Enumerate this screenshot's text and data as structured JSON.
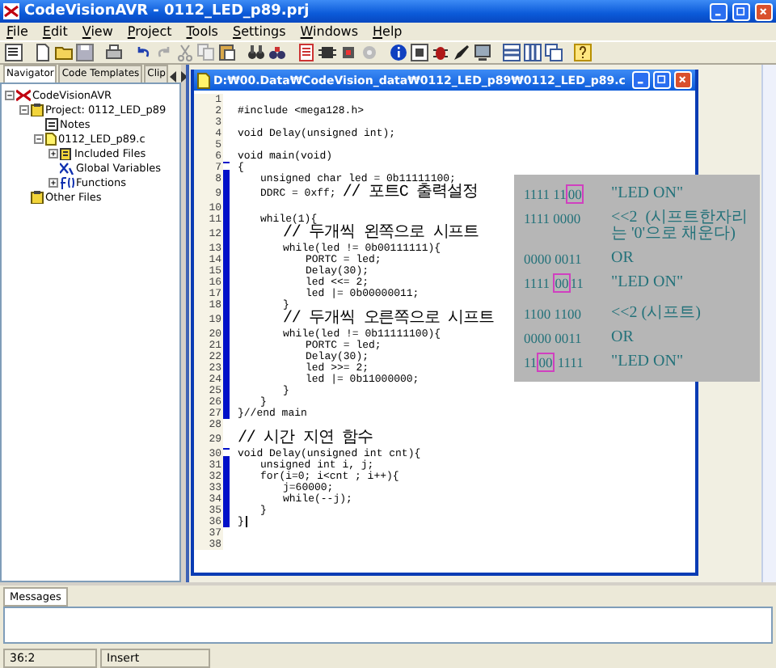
{
  "window": {
    "title": "CodeVisionAVR - 0112_LED_p89.prj"
  },
  "menu": [
    "File",
    "Edit",
    "View",
    "Project",
    "Tools",
    "Settings",
    "Windows",
    "Help"
  ],
  "navigator": {
    "tabs": [
      {
        "label": "Navigator",
        "selected": true
      },
      {
        "label": "Code Templates",
        "selected": false
      },
      {
        "label": "Clip",
        "selected": false
      }
    ],
    "tree": [
      {
        "label": "CodeVisionAVR",
        "kind": "app",
        "expanded": true,
        "children": [
          {
            "label": "Project: 0112_LED_p89",
            "kind": "project",
            "expanded": true,
            "children": [
              {
                "label": "Notes",
                "kind": "notes"
              },
              {
                "label": "0112_LED_p89.c",
                "kind": "file",
                "expanded": true,
                "children": [
                  {
                    "label": "Included Files",
                    "kind": "includes",
                    "expanded": false
                  },
                  {
                    "label": "Global Variables",
                    "kind": "variables"
                  },
                  {
                    "label": "Functions",
                    "kind": "functions",
                    "expanded": false
                  }
                ]
              }
            ]
          },
          {
            "label": "Other Files",
            "kind": "project"
          }
        ]
      }
    ]
  },
  "editor": {
    "title": "D:₩00.Data₩CodeVision_data₩0112_LED_p89₩0112_LED_p89.c",
    "lines": [
      {
        "number": "1",
        "marked": false
      },
      {
        "number": "2",
        "code": "#include <mega128.h>",
        "marked": false
      },
      {
        "number": "3",
        "marked": false
      },
      {
        "number": "4",
        "code": "void Delay(unsigned int);",
        "marked": false
      },
      {
        "number": "5",
        "marked": false
      },
      {
        "number": "6",
        "code": "void main(void)",
        "marked": false
      },
      {
        "number": "7",
        "code": "{",
        "marked": true,
        "fold": true
      },
      {
        "number": "8",
        "code": "\tunsigned char led = 0b11111100;",
        "marked": true
      },
      {
        "number": "9",
        "code": "\tDDRC = 0xff;",
        "comment": "// 포트C 출력설정",
        "marked": true
      },
      {
        "number": "10",
        "marked": true
      },
      {
        "number": "11",
        "code": "\twhile(1){",
        "marked": true
      },
      {
        "number": "12",
        "comment": "\t\t// 두개씩 왼쪽으로 시프트",
        "marked": true
      },
      {
        "number": "13",
        "code": "\t\twhile(led != 0b00111111){",
        "marked": true
      },
      {
        "number": "14",
        "code": "\t\t\tPORTC = led;",
        "marked": true
      },
      {
        "number": "15",
        "code": "\t\t\tDelay(30);",
        "marked": true
      },
      {
        "number": "16",
        "code": "\t\t\tled <<= 2;",
        "marked": true
      },
      {
        "number": "17",
        "code": "\t\t\tled |= 0b00000011;",
        "marked": true
      },
      {
        "number": "18",
        "code": "\t\t}",
        "marked": true
      },
      {
        "number": "19",
        "comment": "\t\t// 두개씩 오른쪽으로 시프트",
        "marked": true
      },
      {
        "number": "20",
        "code": "\t\twhile(led != 0b11111100){",
        "marked": true
      },
      {
        "number": "21",
        "code": "\t\t\tPORTC = led;",
        "marked": true
      },
      {
        "number": "22",
        "code": "\t\t\tDelay(30);",
        "marked": true
      },
      {
        "number": "23",
        "code": "\t\t\tled >>= 2;",
        "marked": true
      },
      {
        "number": "24",
        "code": "\t\t\tled |= 0b11000000;",
        "marked": true
      },
      {
        "number": "25",
        "code": "\t\t}",
        "marked": true
      },
      {
        "number": "26",
        "code": "\t}",
        "marked": true
      },
      {
        "number": "27",
        "code": "}//end main",
        "marked": true
      },
      {
        "number": "28",
        "marked": false
      },
      {
        "number": "29",
        "comment": "// 시간 지연 함수",
        "marked": false
      },
      {
        "number": "30",
        "code": "void Delay(unsigned int cnt){",
        "marked": true,
        "fold": true
      },
      {
        "number": "31",
        "code": "\tunsigned int i, j;",
        "marked": true
      },
      {
        "number": "32",
        "code": "\tfor(i=0; i<cnt ; i++){",
        "marked": true
      },
      {
        "number": "33",
        "code": "\t\tj=60000;",
        "marked": true
      },
      {
        "number": "34",
        "code": "\t\twhile(--j);",
        "marked": true
      },
      {
        "number": "35",
        "code": "\t}",
        "marked": true
      },
      {
        "number": "36",
        "code": "}",
        "marked": true,
        "cursor": true
      },
      {
        "number": "37",
        "marked": false
      },
      {
        "number": "38",
        "marked": false
      }
    ]
  },
  "annotation": {
    "groups": [
      {
        "rows": [
          {
            "bits": [
              {
                "text": "1111 11",
                "boxed": false
              },
              {
                "text": "00",
                "boxed": true
              }
            ],
            "note": "\"LED ON\""
          },
          {
            "bits": [
              {
                "text": "1111 0000",
                "boxed": false
              }
            ],
            "note": "<<2  (시프트한자리는 '0'으로 채운다)"
          },
          {
            "bits": [
              {
                "text": "0000 0011",
                "boxed": false
              }
            ],
            "note": "OR"
          },
          {
            "bits": [
              {
                "text": "1111 ",
                "boxed": false
              },
              {
                "text": "00",
                "boxed": true
              },
              {
                "text": "11",
                "boxed": false
              }
            ],
            "note": "\"LED ON\""
          }
        ]
      },
      {
        "rows": [
          {
            "bits": [
              {
                "text": "1100 1100",
                "boxed": false
              }
            ],
            "note": "<<2 (시프트)"
          },
          {
            "bits": [
              {
                "text": "0000 0011",
                "boxed": false
              }
            ],
            "note": "OR"
          },
          {
            "bits": [
              {
                "text": "11",
                "boxed": false
              },
              {
                "text": "00",
                "boxed": true
              },
              {
                "text": " 1111",
                "boxed": false
              }
            ],
            "note": "\"LED ON\""
          }
        ]
      }
    ]
  },
  "messages": {
    "tab": "Messages"
  },
  "status_bar": [
    "36:2",
    "Insert"
  ]
}
